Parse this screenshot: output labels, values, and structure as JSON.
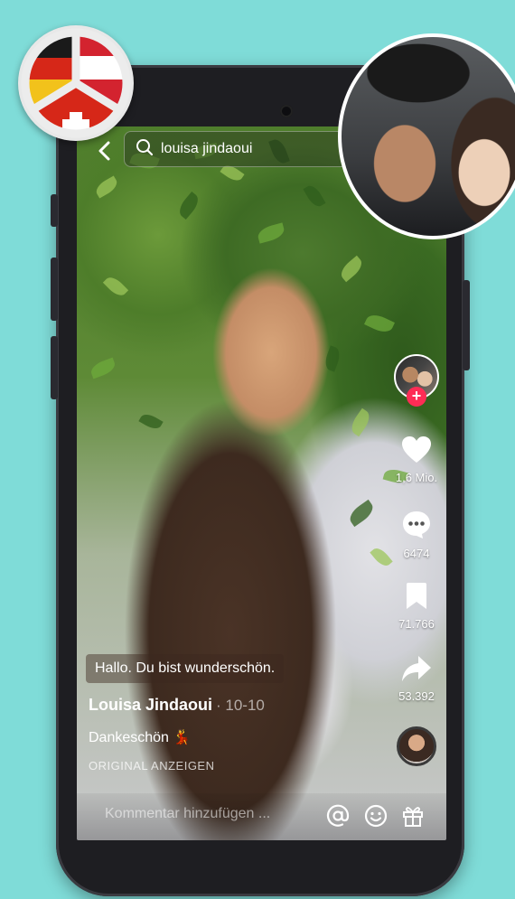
{
  "search": {
    "query": "louisa jindaoui"
  },
  "actions": {
    "likes": "1,6 Mio.",
    "comments": "6474",
    "saves": "71.766",
    "shares": "53.392"
  },
  "video": {
    "sticker_text": "Hallo. Du bist wunderschön.",
    "author": "Louisa Jindaoui",
    "date": "· 10-10",
    "caption": "Dankeschön",
    "caption_emoji": "💃",
    "original_label": "ORIGINAL ANZEIGEN"
  },
  "comment_bar": {
    "placeholder": "Kommentar hinzufügen ..."
  },
  "colors": {
    "background": "#7fdcd8",
    "follow": "#fe2c55"
  }
}
